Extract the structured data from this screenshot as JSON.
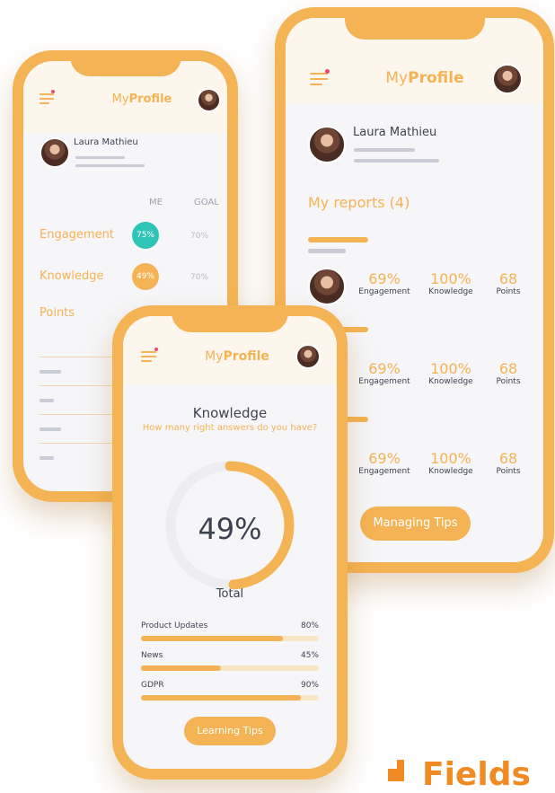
{
  "app": {
    "brand_prefix": "My",
    "brand_bold": "Profile"
  },
  "user": {
    "name": "Laura Mathieu"
  },
  "left_phone": {
    "col_me": "ME",
    "col_goal": "GOAL",
    "rows": [
      {
        "label": "Engagement",
        "me": "75%",
        "goal": "70%",
        "badge_color": "#2ec4b6"
      },
      {
        "label": "Knowledge",
        "me": "49%",
        "goal": "70%",
        "badge_color": "#f4b354"
      },
      {
        "label": "Points"
      }
    ]
  },
  "right_phone": {
    "reports_title": "My reports (4)",
    "reports": [
      {
        "engagement": "69%",
        "engagement_label": "Engagement",
        "knowledge": "100%",
        "knowledge_label": "Knowledge",
        "points": "68",
        "points_label": "Points"
      },
      {
        "engagement": "69%",
        "engagement_label": "Engagement",
        "knowledge": "100%",
        "knowledge_label": "Knowledge",
        "points": "68",
        "points_label": "Points"
      },
      {
        "engagement": "69%",
        "engagement_label": "Engagement",
        "knowledge": "100%",
        "knowledge_label": "Knowledge",
        "points": "68",
        "points_label": "Points"
      }
    ],
    "button_label": "Managing Tips"
  },
  "front_phone": {
    "title": "Knowledge",
    "subtitle": "How many right answers do you have?",
    "gauge_value": "49%",
    "gauge_fraction": 0.49,
    "gauge_label": "Total",
    "categories": [
      {
        "name": "Product Updates",
        "value": "80%",
        "fraction": 0.8
      },
      {
        "name": "News",
        "value": "45%",
        "fraction": 0.45
      },
      {
        "name": "GDPR",
        "value": "90%",
        "fraction": 0.9
      }
    ],
    "button_label": "Learning Tips"
  },
  "logo": {
    "text": "Fields"
  },
  "colors": {
    "accent": "#f4b354",
    "teal": "#2ec4b6",
    "text_dark": "#3d4250",
    "notification": "#ef476f"
  }
}
